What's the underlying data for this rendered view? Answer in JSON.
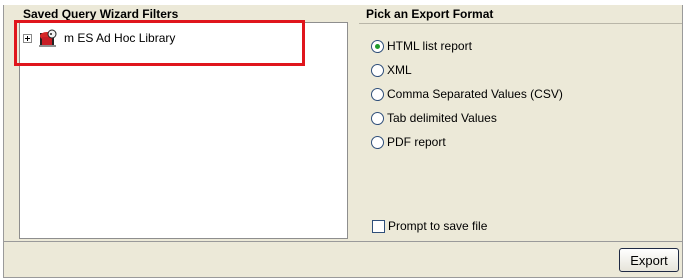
{
  "left_panel": {
    "header": "Saved Query Wizard Filters",
    "tree": [
      {
        "label": "m ES Ad Hoc Library",
        "icon": "library-icon",
        "expander": "plus"
      }
    ]
  },
  "right_panel": {
    "header": "Pick an Export Format",
    "formats": [
      {
        "label": "HTML list report",
        "checked": true
      },
      {
        "label": "XML",
        "checked": false
      },
      {
        "label": "Comma Separated Values (CSV)",
        "checked": false
      },
      {
        "label": "Tab delimited Values",
        "checked": false
      },
      {
        "label": "PDF report",
        "checked": false
      }
    ],
    "prompt_label": "Prompt to save file",
    "prompt_checked": false
  },
  "footer": {
    "export_label": "Export"
  },
  "colors": {
    "highlight_box": "#e0151c",
    "panel_bg": "#ece9d8",
    "radio_dot": "#1f9a2a"
  }
}
